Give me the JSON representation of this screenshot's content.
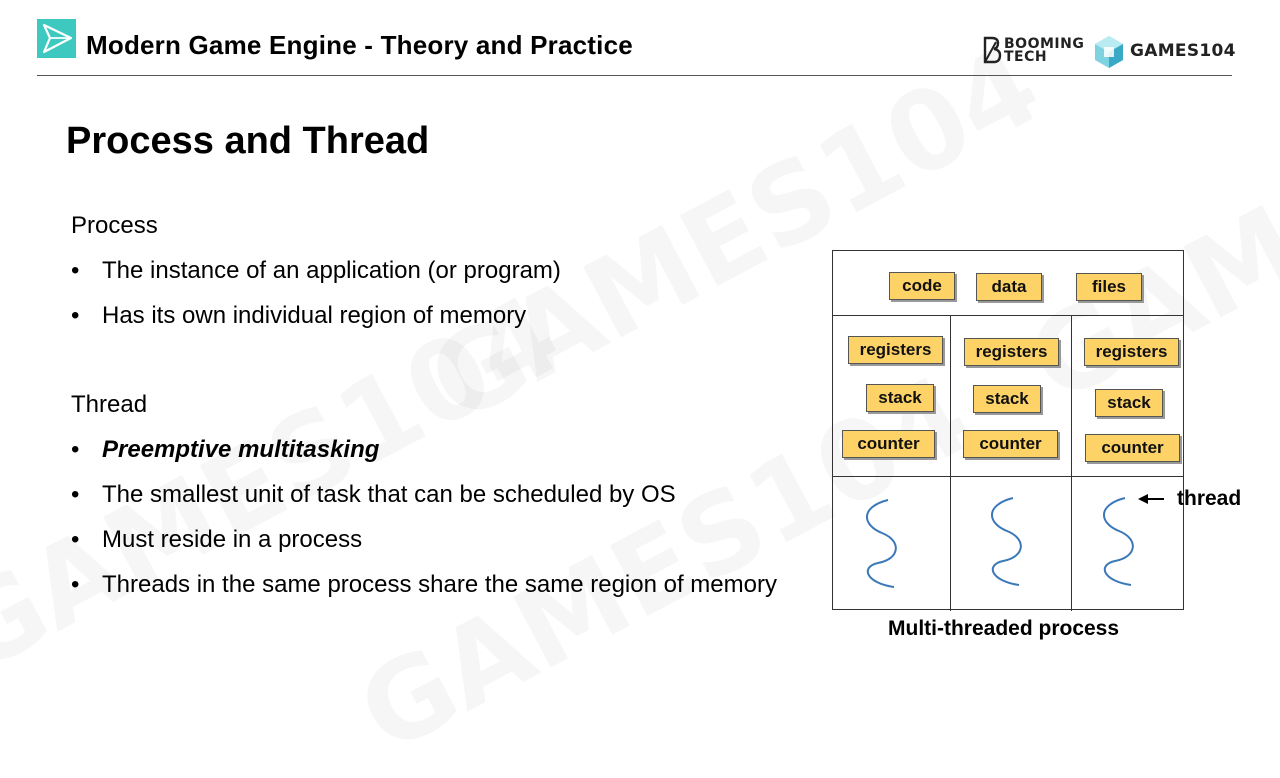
{
  "header": {
    "title": "Modern Game Engine - Theory and Practice",
    "logo_booming": [
      "BOOMING",
      "TECH"
    ],
    "logo_games": "GAMES104",
    "watermark": "GAMES104"
  },
  "slide": {
    "title": "Process and Thread",
    "process": {
      "heading": "Process",
      "bullets": [
        "The instance of an application (or program)",
        "Has its own individual region of memory"
      ]
    },
    "thread": {
      "heading": "Thread",
      "bullets": [
        "Preemptive multitasking",
        "The smallest unit of task that can be scheduled by OS",
        "Must reside in a process",
        "Threads in the same process share the same region of memory"
      ]
    },
    "bullet_char": "•"
  },
  "diagram": {
    "shared": [
      "code",
      "data",
      "files"
    ],
    "per_thread": [
      "registers",
      "stack",
      "counter"
    ],
    "thread_label": "thread",
    "caption": "Multi-threaded process",
    "box_color": "#fdd267",
    "squiggle_color": "#3a78b8"
  },
  "colors": {
    "accent": "#3ec9c0",
    "text": "#000000"
  }
}
